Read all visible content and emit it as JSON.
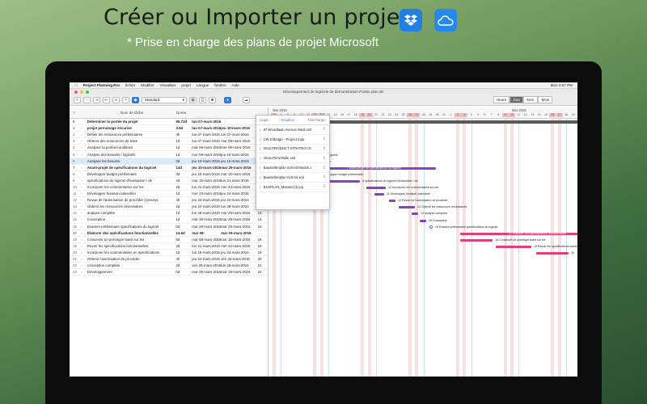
{
  "headline": "Créer ou Importer un projet",
  "subline": "* Prise en charge des plans de projet Microsoft",
  "icons": {
    "dropbox": "dropbox-icon",
    "icloud": "icloud-icon"
  },
  "colors": {
    "accent": "#2f7bd6",
    "bar_blue": "#3d8bd1",
    "bar_purple": "#8a3fc4",
    "bar_pink": "#e0417c"
  },
  "menubar": {
    "app": "Project Planning Pro",
    "items": [
      "fichier",
      "Modifier",
      "Visualiser",
      "projet",
      "Langue",
      "fenêtre",
      "Aide"
    ],
    "clock": "Mon 3:57 PM"
  },
  "window": {
    "title": "Développement de logiciels de démonstration Portée plan de"
  },
  "toolbar": {
    "style_select": "Standard",
    "views": [
      "Heure",
      "Jour",
      "Sem.",
      "Mois"
    ],
    "active_view": "Jour"
  },
  "table": {
    "headers": {
      "name": "Nom de tâche",
      "duration": "Durée"
    },
    "rows": [
      {
        "id": "0",
        "name": "Déterminer la portée du projet",
        "dur": "95.73d",
        "start": "lun 07-mars-2016",
        "end": "",
        "pred": "",
        "bold": true
      },
      {
        "id": "1",
        "name": "projet perrainage sécurisé",
        "dur": "3.5d",
        "start": "lun 07-mars-2016",
        "end": "jeu 10-mars-2016",
        "pred": "",
        "bold": true
      },
      {
        "id": "2",
        "name": "Définir les ressources préliminaires",
        "dur": "4h",
        "start": "lun 07-mars-2016",
        "end": "lun 07-mars-2016",
        "pred": ""
      },
      {
        "id": "3",
        "name": "Obtenir des ressources de base",
        "dur": "1d",
        "start": "lun 07-mars-2016",
        "end": "mar 08-mars-2016",
        "pred": "2"
      },
      {
        "id": "4",
        "name": "Analyser la portée/conditions",
        "dur": "1d",
        "start": "mar 08-mars-2016",
        "end": "mer 09-mars-2016",
        "pred": "3"
      },
      {
        "id": "5",
        "name": "Analyse des besoins / logiciels",
        "dur": "1d",
        "start": "mer 09-mars-2016",
        "end": "jeu 10-mars-2016",
        "pred": "4"
      },
      {
        "id": "6",
        "name": "Analyser les besoins.",
        "dur": "0d",
        "start": "jeu 10-mars-2016",
        "end": "jeu 10-mars-2016",
        "pred": "5",
        "selected": true
      },
      {
        "id": "7",
        "name": "Avant-projet de spécifications du logiciel",
        "dur": "14d",
        "start": "jeu 10-mars-2016",
        "end": "mar 29-mars-2016",
        "pred": "",
        "bold": true
      },
      {
        "id": "8",
        "name": "Développer budget préliminaire",
        "dur": "3d",
        "start": "jeu 10-mars-2016",
        "end": "mar 15-mars-2016",
        "pred": "6"
      },
      {
        "id": "9",
        "name": "spécifications du logiciel d'évaluation / de",
        "dur": "4d",
        "start": "mar 15-mars-2016",
        "end": "lun 21-mars-2016",
        "pred": "8"
      },
      {
        "id": "10",
        "name": "Incorporer les commentaires sur les",
        "dur": "2d",
        "start": "lun 21-mars-2016",
        "end": "mer 23-mars-2016",
        "pred": "9"
      },
      {
        "id": "11",
        "name": "Développer livraison calendrier",
        "dur": "1d",
        "start": "mer 23-mars-2016",
        "end": "jeu 24-mars-2016",
        "pred": "10"
      },
      {
        "id": "12",
        "name": "Revue de l'autorisation de procéder (concept,",
        "dur": "4h",
        "start": "jeu 24-mars-2016",
        "end": "jeu 24-mars-2016",
        "pred": "11"
      },
      {
        "id": "13",
        "name": "Obtenir les ressources nécessaires",
        "dur": "2d",
        "start": "jeu 24-mars-2016",
        "end": "lun 28-mars-2016",
        "pred": "12"
      },
      {
        "id": "14",
        "name": "analyse complète",
        "dur": "1d",
        "start": "lun 28-mars-2016",
        "end": "mar 29-mars-2016",
        "pred": "13"
      },
      {
        "id": "15",
        "name": "Conception",
        "dur": "1d",
        "start": "mar 29-mars-2016",
        "end": "mar 29-mars-2016",
        "pred": "14"
      },
      {
        "id": "16",
        "name": "Examen préliminaire spécifications du logiciel",
        "dur": "0d",
        "start": "mar 29-mars-2016",
        "end": "mar 29-mars-2016",
        "pred": "15"
      },
      {
        "id": "17",
        "name": "Élaborer des spécifications fonctionnelles",
        "dur": "14.5d",
        "start": "mar 08-",
        "end": "mar 29-mars-2016",
        "pred": "",
        "bold": true
      },
      {
        "id": "18",
        "name": "Concevoir un prototype basé sur les",
        "dur": "5d",
        "start": "mar 08-mars-2016",
        "end": "mar 15-mars-2016",
        "pred": "16"
      },
      {
        "id": "19",
        "name": "Revoir les spécifications fonctionnelles.",
        "dur": "2d",
        "start": "lun 21-mars-2016",
        "end": "mer 23-mars-2016",
        "pred": "18"
      },
      {
        "id": "20",
        "name": "Incorporer les commentaires en spécifications",
        "dur": "1d",
        "start": "lun 16-mars-2016",
        "end": "jeu 24-mars-2016",
        "pred": "19"
      },
      {
        "id": "21",
        "name": "Obtenir l'autorisation de procéder",
        "dur": "4h",
        "start": "jeu 24-mars-2016",
        "end": "ven 25-mars-2016",
        "pred": "20"
      },
      {
        "id": "22",
        "name": "conception complète",
        "dur": "2d",
        "start": "ven 25-mars-2016",
        "end": "lun 28-mars-2016",
        "pred": "21"
      },
      {
        "id": "23",
        "name": "Développement",
        "dur": "0d",
        "start": "mar 29-mars-2016",
        "end": "mar 29-mars-2016",
        "pred": "22"
      }
    ]
  },
  "gantt": {
    "months": [
      "Mar 2016",
      "Mar 2016"
    ],
    "days": [
      "6",
      "7",
      "8",
      "9",
      "10",
      "11",
      "12",
      "13",
      "14",
      "15",
      "16",
      "17",
      "18",
      "19",
      "20",
      "21",
      "22",
      "23",
      "24",
      "25",
      "26",
      "27",
      "28",
      "29",
      "30",
      "31",
      "1",
      "2",
      "3",
      "4",
      "5",
      "6",
      "7",
      "8",
      "9",
      "10",
      "11",
      "12",
      "13",
      "14",
      "15",
      "16",
      "17",
      "18",
      "19"
    ],
    "bars": [
      {
        "label": "2 Définir les ressources préliminaires",
        "color": "blue"
      },
      {
        "label": "3 Obtenir des ressources de base",
        "color": "blue"
      },
      {
        "label": "4 portée conditions",
        "color": "blue"
      },
      {
        "label": "5 Analyse des besoins / logiciels",
        "color": "blue"
      },
      {
        "label": "6 Analyser les besoins.",
        "color": "milestone"
      },
      {
        "label": "7 Avant-projet de spécifications du logiciel",
        "color": "purple"
      },
      {
        "label": "8 Développer budget préliminaire",
        "color": "purple"
      },
      {
        "label": "9 spécifications du logiciel d'évaluation / de",
        "color": "purple"
      },
      {
        "label": "10 Incorporer les commentaires sur les",
        "color": "purple"
      },
      {
        "label": "11 Développer livraison calendrier",
        "color": "purple"
      },
      {
        "label": "12 Revue de l'autorisation de procéder",
        "color": "purple"
      },
      {
        "label": "13 Obtenir les ressources nécessaires",
        "color": "purple"
      },
      {
        "label": "14 analyse complète",
        "color": "purple"
      },
      {
        "label": "15 Conception",
        "color": "purple"
      },
      {
        "label": "16 Examen préliminaire spécifications du logiciel",
        "color": "milestone"
      },
      {
        "label": "17 Élaborer des spécifications fonctionnelles",
        "color": "pink"
      },
      {
        "label": "18 Concevoir un prototype basé sur les",
        "color": "pink"
      },
      {
        "label": "19 Revoir les spécifications fonctionnelles",
        "color": "pink"
      },
      {
        "label": "20",
        "color": "pink"
      }
    ]
  },
  "import_popup": {
    "tabs": [
      "Légal",
      "Dropbox",
      "Télécharger"
    ],
    "active_tab": "Dropbox",
    "items": [
      "87 Woodlawn Avenue Medi.xml",
      "135 Eldridge - Project.mpp",
      "2015 PRODUCT STRATEGY.E",
      "AltonaTimeTable.xml",
      "Baustellenplan Schmit Modck.x",
      "Baustellenplan Schmit.xml",
      "BASPLAN_Massed (1).pp"
    ]
  }
}
